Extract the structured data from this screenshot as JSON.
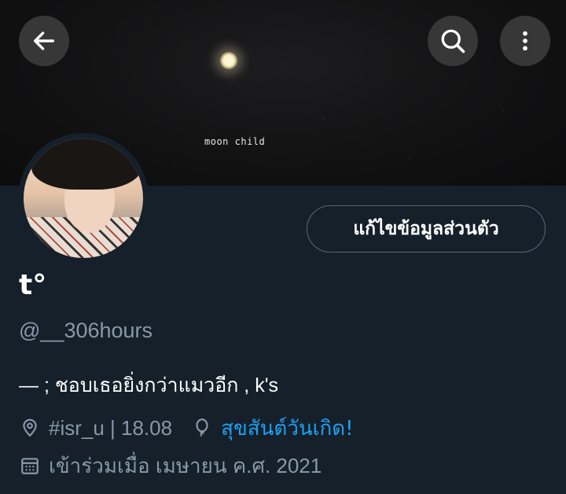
{
  "banner": {
    "caption": "moon child"
  },
  "header": {
    "back_icon": "arrow-left-icon",
    "search_icon": "search-icon",
    "more_icon": "more-vertical-icon"
  },
  "profile": {
    "display_name": "t°",
    "handle": "@__306hours",
    "bio": "— ; ชอบเธอยิ่งกว่าแมวอีก , k's",
    "edit_button_label": "แก้ไขข้อมูลส่วนตัว",
    "location": "#isr_u | 18.08",
    "birthday_link": "สุขสันต์วันเกิด!",
    "joined": "เข้าร่วมเมื่อ เมษายน ค.ศ. 2021"
  },
  "colors": {
    "background": "#15202b",
    "secondary_text": "#8899a6",
    "link": "#1da1f2"
  }
}
